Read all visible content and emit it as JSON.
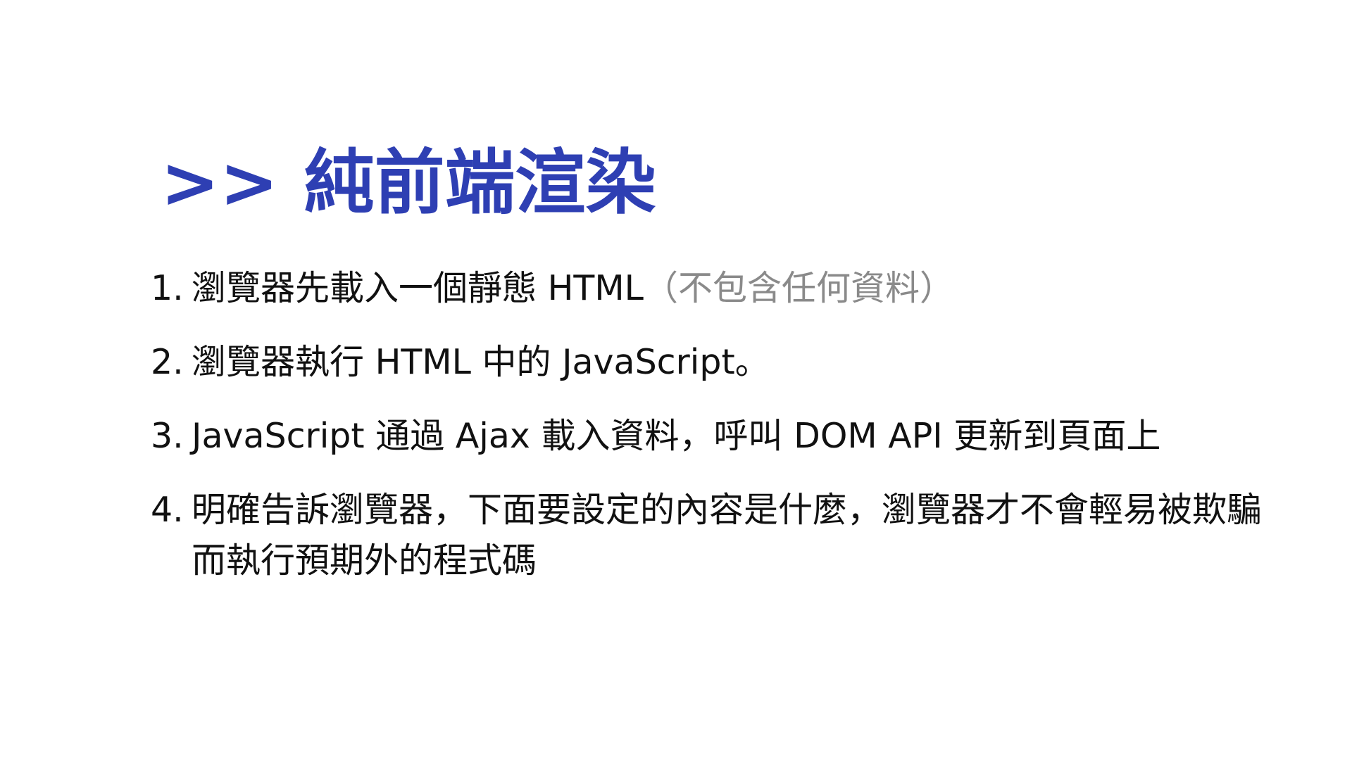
{
  "slide": {
    "title_marker": ">>",
    "title": "純前端渲染",
    "items": [
      {
        "number": "1.",
        "text": "瀏覽器先載入一個靜態 HTML",
        "note": "（不包含任何資料）"
      },
      {
        "number": "2.",
        "text": "瀏覽器執行 HTML 中的 JavaScript。"
      },
      {
        "number": "3.",
        "text": "JavaScript 通過 Ajax 載入資料，呼叫 DOM API 更新到頁面上"
      },
      {
        "number": "4.",
        "text": "明確告訴瀏覽器，下面要設定的內容是什麼，瀏覽器才不會輕易被欺騙而執行預期外的程式碼"
      }
    ]
  },
  "colors": {
    "title": "#2e3fb3",
    "body_text": "#111111",
    "note_text": "#8a8a8a",
    "background": "#ffffff"
  }
}
